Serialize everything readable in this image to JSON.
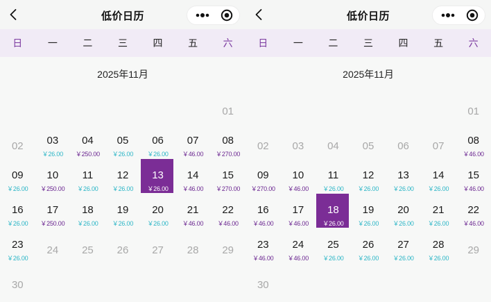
{
  "panels": [
    {
      "title": "低价日历",
      "month_label": "2025年11月",
      "weekdays": [
        "日",
        "一",
        "二",
        "三",
        "四",
        "五",
        "六"
      ],
      "days": [
        {
          "day": "01",
          "state": "past",
          "price": "",
          "tone": ""
        },
        {
          "day": "02",
          "state": "past",
          "price": "",
          "tone": ""
        },
        {
          "day": "03",
          "state": "future",
          "price": "￥26.00",
          "tone": "cyan"
        },
        {
          "day": "04",
          "state": "future",
          "price": "￥250.00",
          "tone": "purple"
        },
        {
          "day": "05",
          "state": "future",
          "price": "￥26.00",
          "tone": "cyan"
        },
        {
          "day": "06",
          "state": "future",
          "price": "￥26.00",
          "tone": "cyan"
        },
        {
          "day": "07",
          "state": "future",
          "price": "￥46.00",
          "tone": "purple"
        },
        {
          "day": "08",
          "state": "future",
          "price": "￥270.00",
          "tone": "purple"
        },
        {
          "day": "09",
          "state": "future",
          "price": "￥26.00",
          "tone": "cyan"
        },
        {
          "day": "10",
          "state": "future",
          "price": "￥250.00",
          "tone": "purple"
        },
        {
          "day": "11",
          "state": "future",
          "price": "￥26.00",
          "tone": "cyan"
        },
        {
          "day": "12",
          "state": "future",
          "price": "￥26.00",
          "tone": "cyan"
        },
        {
          "day": "13",
          "state": "selected",
          "price": "￥26.00",
          "tone": "cyan"
        },
        {
          "day": "14",
          "state": "future",
          "price": "￥46.00",
          "tone": "purple"
        },
        {
          "day": "15",
          "state": "future",
          "price": "￥270.00",
          "tone": "purple"
        },
        {
          "day": "16",
          "state": "future",
          "price": "￥26.00",
          "tone": "cyan"
        },
        {
          "day": "17",
          "state": "future",
          "price": "￥250.00",
          "tone": "purple"
        },
        {
          "day": "18",
          "state": "future",
          "price": "￥26.00",
          "tone": "cyan"
        },
        {
          "day": "19",
          "state": "future",
          "price": "￥26.00",
          "tone": "cyan"
        },
        {
          "day": "20",
          "state": "future",
          "price": "￥26.00",
          "tone": "cyan"
        },
        {
          "day": "21",
          "state": "future",
          "price": "￥46.00",
          "tone": "purple"
        },
        {
          "day": "22",
          "state": "future",
          "price": "￥46.00",
          "tone": "purple"
        },
        {
          "day": "23",
          "state": "future",
          "price": "￥26.00",
          "tone": "cyan"
        },
        {
          "day": "24",
          "state": "past",
          "price": "",
          "tone": ""
        },
        {
          "day": "25",
          "state": "past",
          "price": "",
          "tone": ""
        },
        {
          "day": "26",
          "state": "past",
          "price": "",
          "tone": ""
        },
        {
          "day": "27",
          "state": "past",
          "price": "",
          "tone": ""
        },
        {
          "day": "28",
          "state": "past",
          "price": "",
          "tone": ""
        },
        {
          "day": "29",
          "state": "past",
          "price": "",
          "tone": ""
        },
        {
          "day": "30",
          "state": "past",
          "price": "",
          "tone": ""
        }
      ]
    },
    {
      "title": "低价日历",
      "month_label": "2025年11月",
      "weekdays": [
        "日",
        "一",
        "二",
        "三",
        "四",
        "五",
        "六"
      ],
      "days": [
        {
          "day": "01",
          "state": "past",
          "price": "",
          "tone": ""
        },
        {
          "day": "02",
          "state": "past",
          "price": "",
          "tone": ""
        },
        {
          "day": "03",
          "state": "past",
          "price": "",
          "tone": ""
        },
        {
          "day": "04",
          "state": "past",
          "price": "",
          "tone": ""
        },
        {
          "day": "05",
          "state": "past",
          "price": "",
          "tone": ""
        },
        {
          "day": "06",
          "state": "past",
          "price": "",
          "tone": ""
        },
        {
          "day": "07",
          "state": "past",
          "price": "",
          "tone": ""
        },
        {
          "day": "08",
          "state": "future",
          "price": "￥46.00",
          "tone": "purple"
        },
        {
          "day": "09",
          "state": "future",
          "price": "￥270.00",
          "tone": "purple"
        },
        {
          "day": "10",
          "state": "future",
          "price": "￥46.00",
          "tone": "purple"
        },
        {
          "day": "11",
          "state": "future",
          "price": "￥26.00",
          "tone": "cyan"
        },
        {
          "day": "12",
          "state": "future",
          "price": "￥26.00",
          "tone": "cyan"
        },
        {
          "day": "13",
          "state": "future",
          "price": "￥26.00",
          "tone": "cyan"
        },
        {
          "day": "14",
          "state": "future",
          "price": "￥26.00",
          "tone": "cyan"
        },
        {
          "day": "15",
          "state": "future",
          "price": "￥46.00",
          "tone": "purple"
        },
        {
          "day": "16",
          "state": "future",
          "price": "￥46.00",
          "tone": "purple"
        },
        {
          "day": "17",
          "state": "future",
          "price": "￥46.00",
          "tone": "purple"
        },
        {
          "day": "18",
          "state": "selected",
          "price": "￥26.00",
          "tone": "cyan"
        },
        {
          "day": "19",
          "state": "future",
          "price": "￥26.00",
          "tone": "cyan"
        },
        {
          "day": "20",
          "state": "future",
          "price": "￥26.00",
          "tone": "cyan"
        },
        {
          "day": "21",
          "state": "future",
          "price": "￥26.00",
          "tone": "cyan"
        },
        {
          "day": "22",
          "state": "future",
          "price": "￥46.00",
          "tone": "purple"
        },
        {
          "day": "23",
          "state": "future",
          "price": "￥46.00",
          "tone": "purple"
        },
        {
          "day": "24",
          "state": "future",
          "price": "￥46.00",
          "tone": "purple"
        },
        {
          "day": "25",
          "state": "future",
          "price": "￥26.00",
          "tone": "cyan"
        },
        {
          "day": "26",
          "state": "future",
          "price": "￥26.00",
          "tone": "cyan"
        },
        {
          "day": "27",
          "state": "future",
          "price": "￥26.00",
          "tone": "cyan"
        },
        {
          "day": "28",
          "state": "future",
          "price": "￥26.00",
          "tone": "cyan"
        },
        {
          "day": "29",
          "state": "past",
          "price": "",
          "tone": ""
        },
        {
          "day": "30",
          "state": "past",
          "price": "",
          "tone": ""
        }
      ]
    }
  ],
  "icons": {
    "back": "chevron-left-icon",
    "more": "more-dots-icon",
    "close": "target-close-icon"
  },
  "colors": {
    "accent_purple": "#7b2d96",
    "weekday_bar": "#f1ebf6",
    "weekend_text": "#7b3aa0",
    "price_cyan": "#2ab5c6",
    "price_purple": "#6a2590",
    "past_gray": "#a8a8a8"
  }
}
